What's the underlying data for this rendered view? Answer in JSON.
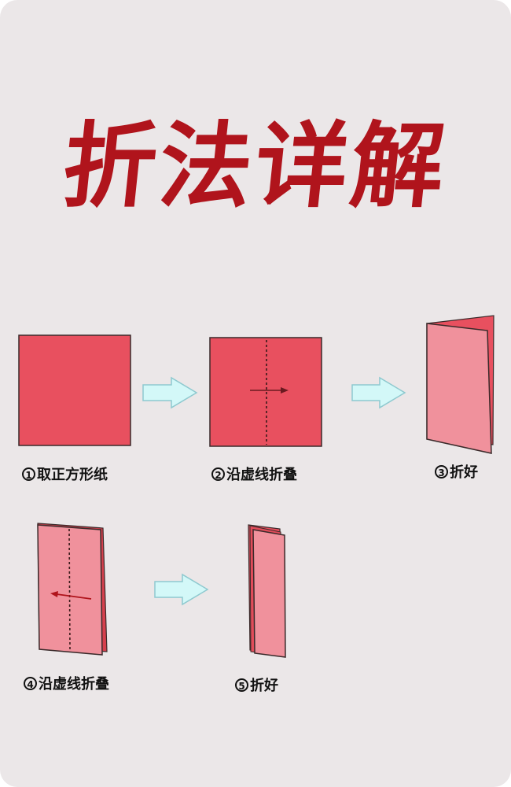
{
  "title": "折法详解",
  "steps": [
    {
      "number": "1",
      "text": "取正方形纸"
    },
    {
      "number": "2",
      "text": "沿虚线折叠"
    },
    {
      "number": "3",
      "text": "折好"
    },
    {
      "number": "4",
      "text": "沿虚线折叠"
    },
    {
      "number": "5",
      "text": "折好"
    }
  ],
  "colors": {
    "background": "#ebe7e8",
    "title": "#b0141c",
    "paper": "#e8505f",
    "paper_folded": "#f0919c",
    "arrow_fill": "#d3f8f8",
    "arrow_stroke": "#8ec9cf"
  }
}
